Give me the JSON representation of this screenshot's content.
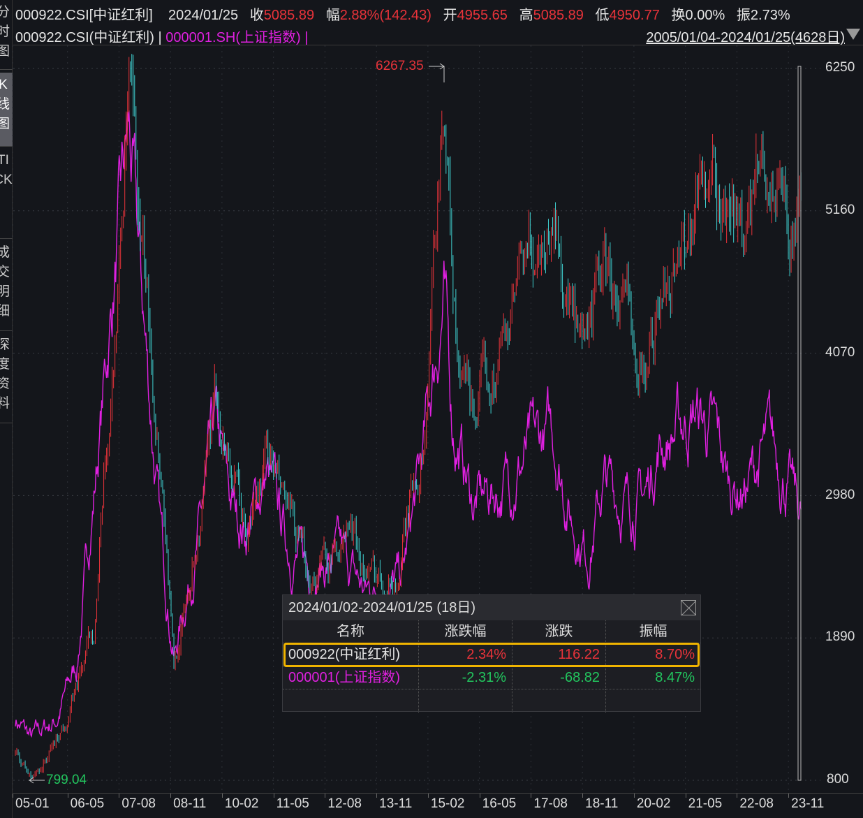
{
  "sidebar": {
    "tabs": [
      "分时图",
      "K线图",
      "TICK",
      "成交明细",
      "深度资料"
    ],
    "active": 1
  },
  "header": {
    "symbol": "000922.CSI[中证红利]",
    "date": "2024/01/25",
    "close_label": "收",
    "close": "5085.89",
    "change_label": "幅",
    "change": "2.88%(142.43)",
    "open_label": "开",
    "open": "4955.65",
    "high_label": "高",
    "high": "5085.89",
    "low_label": "低",
    "low": "4950.77",
    "turnover_label": "换",
    "turnover": "0.00%",
    "amplitude_label": "振",
    "amplitude": "2.73%"
  },
  "legend": {
    "main": "000922.CSI(中证红利)",
    "sep": "|",
    "compare": "000001.SH(上证指数)",
    "sep2": "|"
  },
  "range": "2005/01/04-2024/01/25(4628日)",
  "annotations": {
    "high": "6267.35",
    "low": "799.04"
  },
  "colors": {
    "up": "#e8333a",
    "down": "#3fd0d0",
    "compare": "#e020e0",
    "highlight": "#f0b400"
  },
  "chart_data": {
    "type": "line",
    "y_ticks": [
      "6250",
      "5160",
      "4070",
      "2980",
      "1890",
      "800"
    ],
    "ylim": [
      800,
      6250
    ],
    "x_ticks": [
      "05-01",
      "06-05",
      "07-08",
      "08-11",
      "10-02",
      "11-05",
      "12-08",
      "13-11",
      "15-02",
      "16-05",
      "17-08",
      "18-11",
      "20-02",
      "21-05",
      "22-08",
      "23-11"
    ],
    "xlim": [
      2005.0,
      2024.07
    ],
    "series": [
      {
        "name": "000922.CSI(中证红利)",
        "style": "candles",
        "points": [
          [
            2005.0,
            1003
          ],
          [
            2005.4,
            800
          ],
          [
            2006.0,
            1110
          ],
          [
            2006.4,
            1431
          ],
          [
            2006.9,
            1965
          ],
          [
            2007.3,
            3568
          ],
          [
            2007.6,
            5171
          ],
          [
            2007.75,
            6079
          ],
          [
            2008.0,
            4904
          ],
          [
            2008.3,
            4102
          ],
          [
            2008.6,
            3034
          ],
          [
            2008.85,
            1644
          ],
          [
            2009.3,
            2499
          ],
          [
            2009.88,
            3621
          ],
          [
            2010.2,
            3301
          ],
          [
            2010.6,
            2606
          ],
          [
            2011.15,
            3301
          ],
          [
            2011.6,
            2766
          ],
          [
            2012.1,
            2339
          ],
          [
            2013.1,
            2713
          ],
          [
            2013.6,
            2339
          ],
          [
            2014.3,
            2392
          ],
          [
            2014.95,
            3568
          ],
          [
            2015.4,
            6267
          ],
          [
            2015.55,
            5171
          ],
          [
            2015.75,
            3835
          ],
          [
            2016.1,
            3568
          ],
          [
            2016.6,
            3995
          ],
          [
            2017.2,
            4476
          ],
          [
            2018.07,
            5171
          ],
          [
            2018.4,
            4530
          ],
          [
            2018.78,
            3835
          ],
          [
            2019.3,
            4743
          ],
          [
            2019.7,
            4316
          ],
          [
            2020.3,
            4102
          ],
          [
            2020.9,
            4743
          ],
          [
            2021.4,
            5171
          ],
          [
            2021.7,
            5545
          ],
          [
            2022.0,
            5171
          ],
          [
            2022.5,
            5010
          ],
          [
            2022.9,
            5171
          ],
          [
            2023.3,
            5438
          ],
          [
            2023.7,
            5171
          ],
          [
            2024.07,
            5086
          ]
        ]
      },
      {
        "name": "000001.SH(上证指数)",
        "style": "line",
        "points": [
          [
            2005.0,
            1270
          ],
          [
            2005.4,
            1110
          ],
          [
            2006.0,
            1270
          ],
          [
            2006.5,
            1698
          ],
          [
            2007.0,
            3301
          ],
          [
            2007.4,
            4636
          ],
          [
            2007.75,
            5705
          ],
          [
            2008.1,
            4369
          ],
          [
            2008.5,
            2766
          ],
          [
            2008.85,
            1751
          ],
          [
            2009.5,
            2766
          ],
          [
            2009.85,
            3461
          ],
          [
            2010.2,
            2927
          ],
          [
            2010.6,
            2713
          ],
          [
            2011.1,
            3140
          ],
          [
            2011.6,
            2606
          ],
          [
            2012.2,
            2392
          ],
          [
            2012.9,
            2499
          ],
          [
            2013.5,
            2232
          ],
          [
            2014.4,
            2339
          ],
          [
            2014.9,
            3301
          ],
          [
            2015.4,
            4530
          ],
          [
            2015.6,
            3568
          ],
          [
            2016.1,
            2927
          ],
          [
            2016.8,
            3034
          ],
          [
            2017.3,
            3247
          ],
          [
            2018.05,
            3461
          ],
          [
            2018.5,
            2820
          ],
          [
            2018.9,
            2553
          ],
          [
            2019.3,
            3087
          ],
          [
            2019.8,
            2927
          ],
          [
            2020.3,
            2980
          ],
          [
            2020.6,
            3354
          ],
          [
            2021.0,
            3461
          ],
          [
            2021.5,
            3621
          ],
          [
            2022.0,
            3408
          ],
          [
            2022.3,
            3087
          ],
          [
            2022.7,
            3034
          ],
          [
            2023.3,
            3354
          ],
          [
            2023.7,
            3140
          ],
          [
            2024.07,
            2820
          ]
        ]
      }
    ]
  },
  "popup": {
    "title": "2024/01/02-2024/01/25 (18日)",
    "columns": [
      "名称",
      "涨跌幅",
      "涨跌",
      "振幅"
    ],
    "rows": [
      {
        "name": "000922(中证红利)",
        "pct": "2.34%",
        "chg": "116.22",
        "amp": "8.70%"
      },
      {
        "name": "000001(上证指数)",
        "pct": "-2.31%",
        "chg": "-68.82",
        "amp": "8.47%"
      }
    ]
  }
}
